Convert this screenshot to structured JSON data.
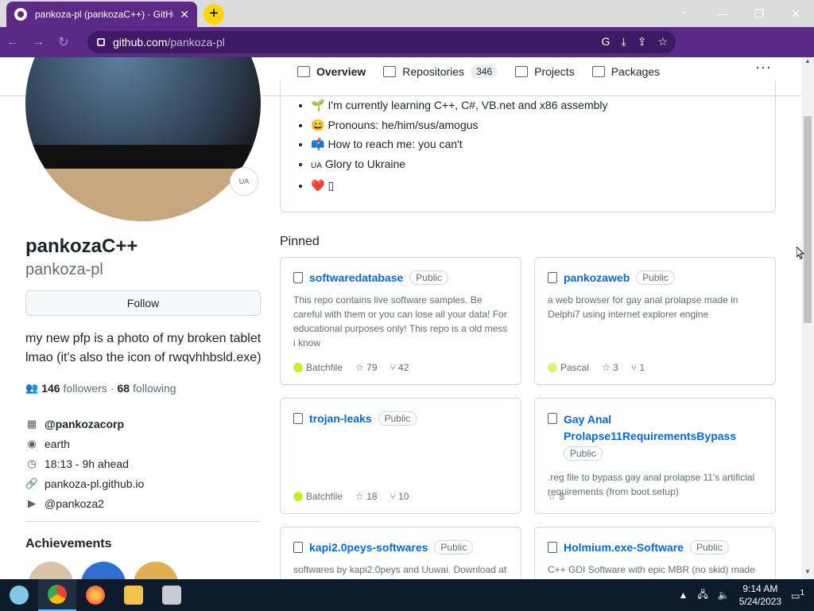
{
  "browser": {
    "tab_title": "pankoza-pl (pankozaC++) · GitHub",
    "url_host": "github.com",
    "url_path": "/pankoza-pl"
  },
  "nav": {
    "tabs": [
      {
        "label": "Overview",
        "active": true
      },
      {
        "label": "Repositories",
        "count": "346"
      },
      {
        "label": "Projects"
      },
      {
        "label": "Packages"
      }
    ]
  },
  "profile": {
    "avatar_badge": "UA",
    "name": "pankozaC++",
    "login": "pankoza-pl",
    "follow_label": "Follow",
    "bio": "my new pfp is a photo of my broken tablet lmao (it's also the icon of rwqvhhbsld.exe)",
    "followers_count": "146",
    "followers_label": "followers",
    "sep": "·",
    "following_count": "68",
    "following_label": "following",
    "org": "@pankozacorp",
    "location": "earth",
    "time": "18:13 - 9h ahead",
    "website": "pankoza-pl.github.io",
    "youtube": "@pankoza2",
    "achievements_title": "Achievements"
  },
  "readme": {
    "items": [
      {
        "emoji": "🌱",
        "text": "I'm currently learning C++, C#, VB.net and x86 assembly"
      },
      {
        "emoji": "😄",
        "text": "Pronouns: he/him/sus/amogus"
      },
      {
        "emoji": "📫",
        "text": "How to reach me: you can't"
      },
      {
        "emoji": "UA",
        "text": "Glory to Ukraine"
      },
      {
        "emoji": "❤️",
        "text": "▯"
      }
    ]
  },
  "pinned": {
    "title": "Pinned",
    "cards": [
      {
        "name": "softwaredatabase",
        "visibility": "Public",
        "description": "This repo contains live software samples. Be careful with them or you can lose all your data! For educational purposes only! This repo is a old mess i know",
        "language": "Batchfile",
        "lang_color": "#c1f12e",
        "stars": "79",
        "forks": "42"
      },
      {
        "name": "pankozaweb",
        "visibility": "Public",
        "description": "a web browser for gay anal prolapse made in Delphi7 using internet explorer engine",
        "language": "Pascal",
        "lang_color": "#E3F171",
        "stars": "3",
        "forks": "1"
      },
      {
        "name": "trojan-leaks",
        "visibility": "Public",
        "description": "",
        "language": "Batchfile",
        "lang_color": "#c1f12e",
        "stars": "18",
        "forks": "10"
      },
      {
        "name": "Gay Anal Prolapse11RequirementsBypass",
        "visibility": "Public",
        "description": ".reg file to bypass gay anal prolapse 11's artificial requirements (from boot setup)",
        "language": "",
        "lang_color": "",
        "stars": "3",
        "forks": ""
      },
      {
        "name": "kapi2.0peys-softwares",
        "visibility": "Public",
        "description": "softwares by kapi2.0peys and Uuwai. Download at",
        "language": "",
        "lang_color": "",
        "stars": "",
        "forks": ""
      },
      {
        "name": "Holmium.exe-Software",
        "visibility": "Public",
        "description": "C++ GDI Software with epic MBR (no skid) made for",
        "language": "",
        "lang_color": "",
        "stars": "",
        "forks": ""
      }
    ]
  },
  "taskbar": {
    "time": "9:14 AM",
    "date": "5/24/2023",
    "notif_count": "1"
  }
}
